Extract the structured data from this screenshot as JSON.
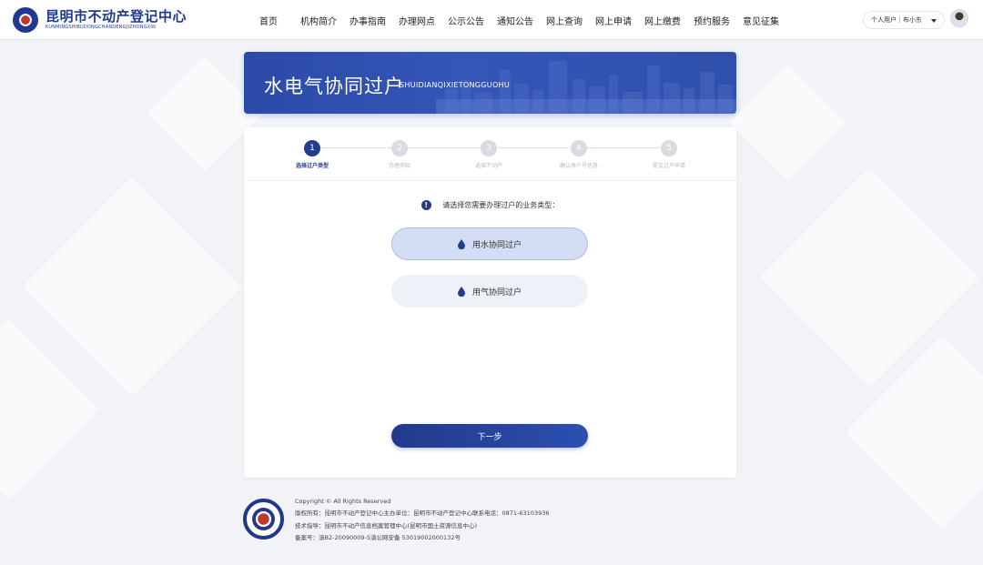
{
  "header": {
    "logo_cn": "昆明市不动产登记中心",
    "logo_en": "KUNMINGSHIBUDONGCHANDENGJIZHONGXIN",
    "nav": [
      "首页",
      "机构简介",
      "办事指南",
      "办理网点",
      "公示公告",
      "通知公告",
      "网上查询",
      "网上申请",
      "网上缴费",
      "预约服务",
      "意见征集"
    ],
    "user_menu": "个人用户｜布小东"
  },
  "banner": {
    "title": "水电气协同过户",
    "subtitle": "SHUIDIANQIXIETONGGUOHU"
  },
  "steps": [
    {
      "num": "1",
      "label": "选择过户类型",
      "active": true
    },
    {
      "num": "2",
      "label": "办理须知",
      "active": false
    },
    {
      "num": "3",
      "label": "选择不动产",
      "active": false
    },
    {
      "num": "4",
      "label": "确认原户号信息",
      "active": false
    },
    {
      "num": "5",
      "label": "提交过户申请",
      "active": false
    }
  ],
  "prompt": {
    "icon": "!",
    "text": "请选择您需要办理过户的业务类型："
  },
  "options": [
    {
      "label": "用水协同过户",
      "selected": true,
      "icon": "water-drop-icon"
    },
    {
      "label": "用气协同过户",
      "selected": false,
      "icon": "gas-drop-icon"
    }
  ],
  "next_button": "下一步",
  "footer": {
    "lines": [
      "Copyright © All Rights Reserved",
      "版权所有：昆明市不动产登记中心主办单位：昆明市不动产登记中心联系电话：0871-63103936",
      "技术指导：昆明市不动产信息档案管理中心(昆明市国土资源信息中心)",
      "备案号：滇B2-20090009-5滇公网安备 53019002000132号"
    ]
  },
  "colors": {
    "primary": "#243c8c",
    "banner": "#2f4fab",
    "option_selected": "#d3ddf3",
    "option_unselected": "#eef1f7"
  }
}
